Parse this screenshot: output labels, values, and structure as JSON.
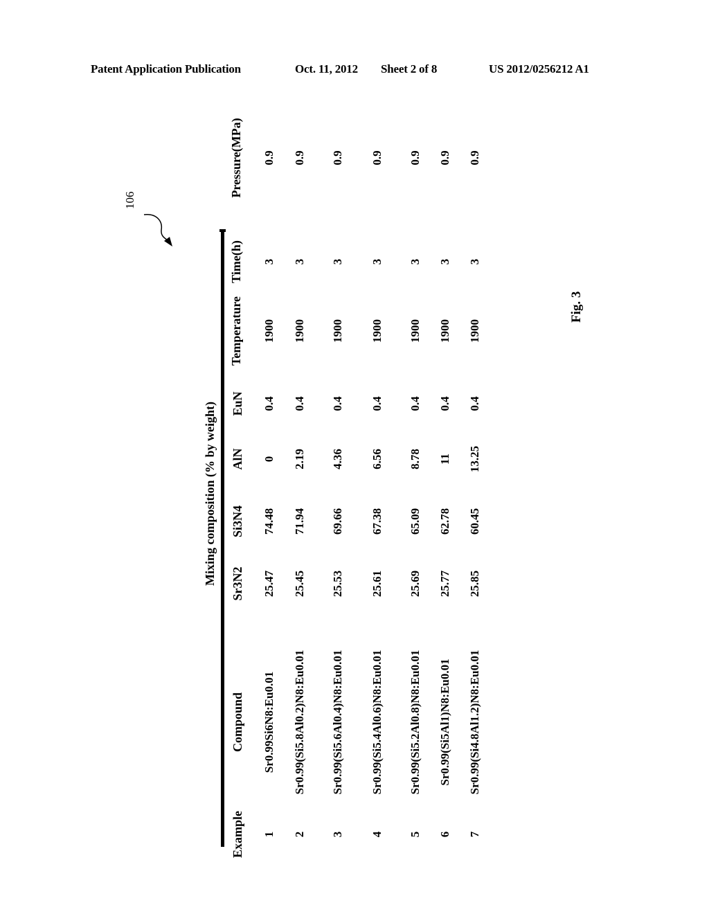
{
  "header": {
    "publication": "Patent Application Publication",
    "date": "Oct. 11, 2012",
    "sheet": "Sheet 2 of 8",
    "number": "US 2012/0256212 A1"
  },
  "reference_numeral": "106",
  "figure_label": "Fig. 3",
  "table": {
    "group_title": "Mixing composition (% by weight)",
    "columns": [
      "Example",
      "Compound",
      "Sr3N2",
      "Si3N4",
      "AlN",
      "EuN",
      "Temperature",
      "Time(h)",
      "Pressure(MPa)"
    ],
    "rows": [
      [
        "1",
        "Sr0.99Si6N8:Eu0.01",
        "25.47",
        "74.48",
        "0",
        "0.4",
        "1900",
        "3",
        "0.9"
      ],
      [
        "2",
        "Sr0.99(Si5.8Al0.2)N8:Eu0.01",
        "25.45",
        "71.94",
        "2.19",
        "0.4",
        "1900",
        "3",
        "0.9"
      ],
      [
        "3",
        "Sr0.99(Si5.6Al0.4)N8:Eu0.01",
        "25.53",
        "69.66",
        "4.36",
        "0.4",
        "1900",
        "3",
        "0.9"
      ],
      [
        "4",
        "Sr0.99(Si5.4Al0.6)N8:Eu0.01",
        "25.61",
        "67.38",
        "6.56",
        "0.4",
        "1900",
        "3",
        "0.9"
      ],
      [
        "5",
        "Sr0.99(Si5.2Al0.8)N8:Eu0.01",
        "25.69",
        "65.09",
        "8.78",
        "0.4",
        "1900",
        "3",
        "0.9"
      ],
      [
        "6",
        "Sr0.99(Si5Al1)N8:Eu0.01",
        "25.77",
        "62.78",
        "11",
        "0.4",
        "1900",
        "3",
        "0.9"
      ],
      [
        "7",
        "Sr0.99(Si4.8Al1.2)N8:Eu0.01",
        "25.85",
        "60.45",
        "13.25",
        "0.4",
        "1900",
        "3",
        "0.9"
      ]
    ]
  }
}
